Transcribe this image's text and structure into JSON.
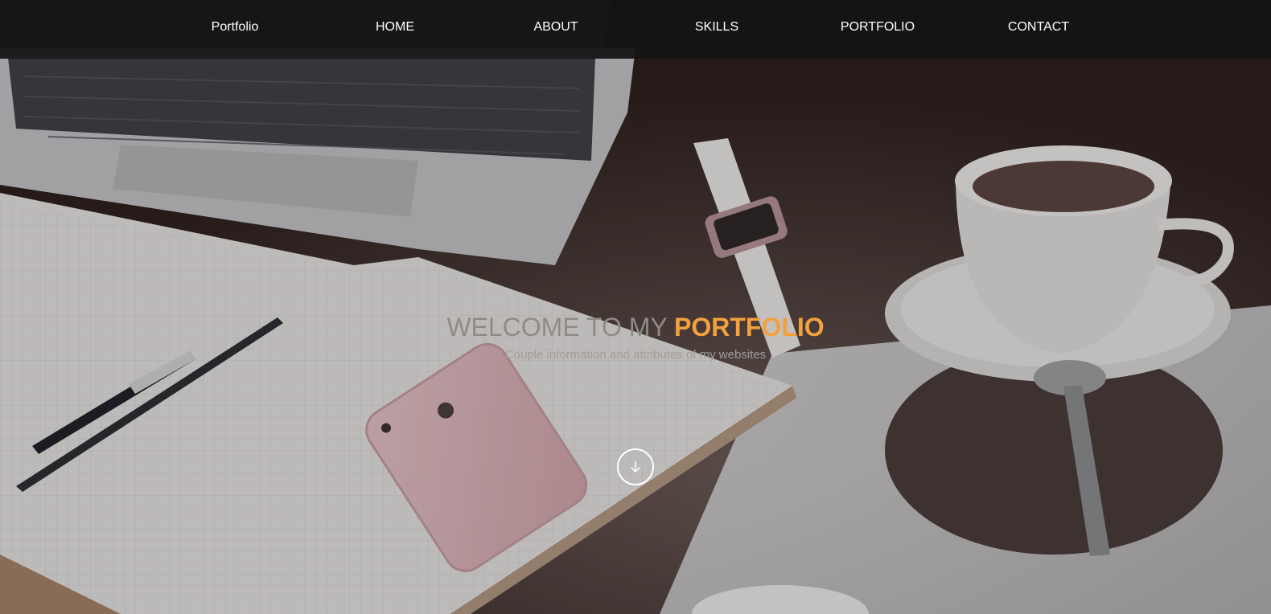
{
  "nav": {
    "brand": "Portfolio",
    "items": [
      {
        "label": "HOME"
      },
      {
        "label": "ABOUT"
      },
      {
        "label": "SKILLS"
      },
      {
        "label": "PORTFOLIO"
      },
      {
        "label": "CONTACT"
      }
    ]
  },
  "hero": {
    "welcome_text": "WELCOME TO MY",
    "highlight_text": "PORTFOLIO",
    "subtitle": "Couple information and attributes of my websites",
    "scroll_icon": "arrow-down-icon"
  },
  "colors": {
    "navbar_bg": "#141214",
    "nav_text": "#ffffff",
    "accent": "#f3a03e",
    "headline_muted": "#8f8b87",
    "subtitle": "#a19d99"
  }
}
